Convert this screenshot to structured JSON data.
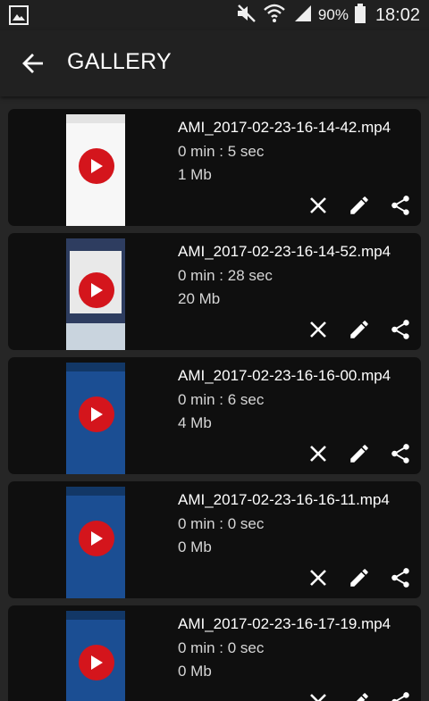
{
  "status_bar": {
    "battery_percent": "90%",
    "time": "18:02",
    "icons": [
      "gallery-notification-icon",
      "mute-icon",
      "wifi-icon",
      "signal-icon",
      "battery-icon"
    ]
  },
  "header": {
    "back_icon": "arrow-left-icon",
    "title": "GALLERY"
  },
  "colors": {
    "play_button": "#d4151c",
    "card_background": "#0f0f0f",
    "page_background": "#262626"
  },
  "videos": [
    {
      "name": "AMI_2017-02-23-16-14-42.mp4",
      "duration": "0 min : 5 sec",
      "size": "1 Mb"
    },
    {
      "name": "AMI_2017-02-23-16-14-52.mp4",
      "duration": "0 min : 28 sec",
      "size": "20 Mb"
    },
    {
      "name": "AMI_2017-02-23-16-16-00.mp4",
      "duration": "0 min : 6 sec",
      "size": "4 Mb"
    },
    {
      "name": "AMI_2017-02-23-16-16-11.mp4",
      "duration": "0 min : 0 sec",
      "size": "0 Mb"
    },
    {
      "name": "AMI_2017-02-23-16-17-19.mp4",
      "duration": "0 min : 0 sec",
      "size": "0 Mb"
    }
  ],
  "actions": [
    "close-icon",
    "edit-pencil-icon",
    "share-icon"
  ]
}
